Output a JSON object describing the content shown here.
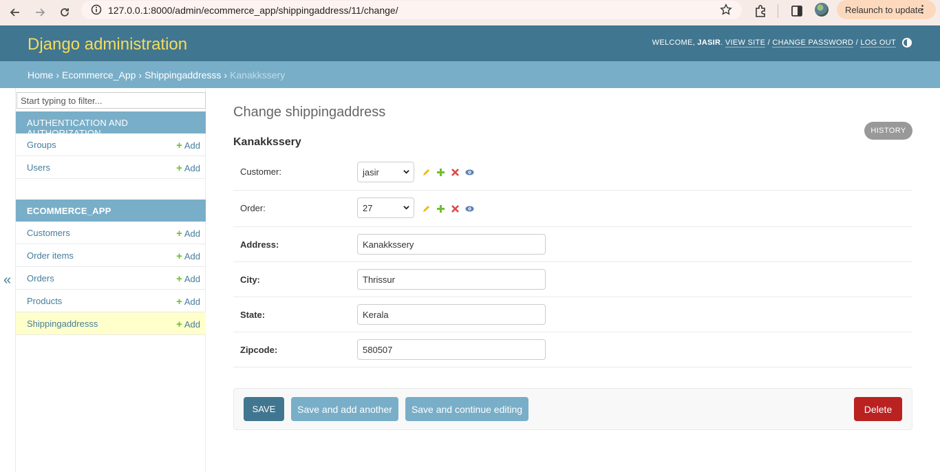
{
  "browser": {
    "url": "127.0.0.1:8000/admin/ecommerce_app/shippingaddress/11/change/",
    "relaunch_label": "Relaunch to update"
  },
  "header": {
    "branding": "Django administration",
    "welcome": "WELCOME,",
    "username": "JASIR",
    "view_site": "VIEW SITE",
    "change_password": "CHANGE PASSWORD",
    "log_out": "LOG OUT"
  },
  "breadcrumbs": {
    "home": "Home",
    "app": "Ecommerce_App",
    "model": "Shippingaddresss",
    "current": "Kanakkssery"
  },
  "sidebar": {
    "filter_placeholder": "Start typing to filter...",
    "add_label": "Add",
    "modules": [
      {
        "caption": "Authentication and Authorization",
        "models": [
          {
            "label": "Groups"
          },
          {
            "label": "Users"
          }
        ]
      },
      {
        "caption": "Ecommerce_App",
        "models": [
          {
            "label": "Customers"
          },
          {
            "label": "Order items"
          },
          {
            "label": "Orders"
          },
          {
            "label": "Products"
          },
          {
            "label": "Shippingaddresss"
          }
        ]
      }
    ],
    "collapse_glyph": "«"
  },
  "content": {
    "title": "Change shippingaddress",
    "history_label": "History",
    "object_title": "Kanakkssery",
    "fields": {
      "customer": {
        "label": "Customer:",
        "value": "jasir"
      },
      "order": {
        "label": "Order:",
        "value": "27"
      },
      "address": {
        "label": "Address:",
        "value": "Kanakkssery"
      },
      "city": {
        "label": "City:",
        "value": "Thrissur"
      },
      "state": {
        "label": "State:",
        "value": "Kerala"
      },
      "zipcode": {
        "label": "Zipcode:",
        "value": "580507"
      }
    }
  },
  "submit": {
    "save": "SAVE",
    "save_add": "Save and add another",
    "save_continue": "Save and continue editing",
    "delete": "Delete"
  },
  "colors": {
    "header": "#417690",
    "breadcrumbs": "#79aec8",
    "branding": "#f5dd5d",
    "link": "#447e9b",
    "delete": "#ba2121",
    "current_row": "#ffffcc"
  }
}
